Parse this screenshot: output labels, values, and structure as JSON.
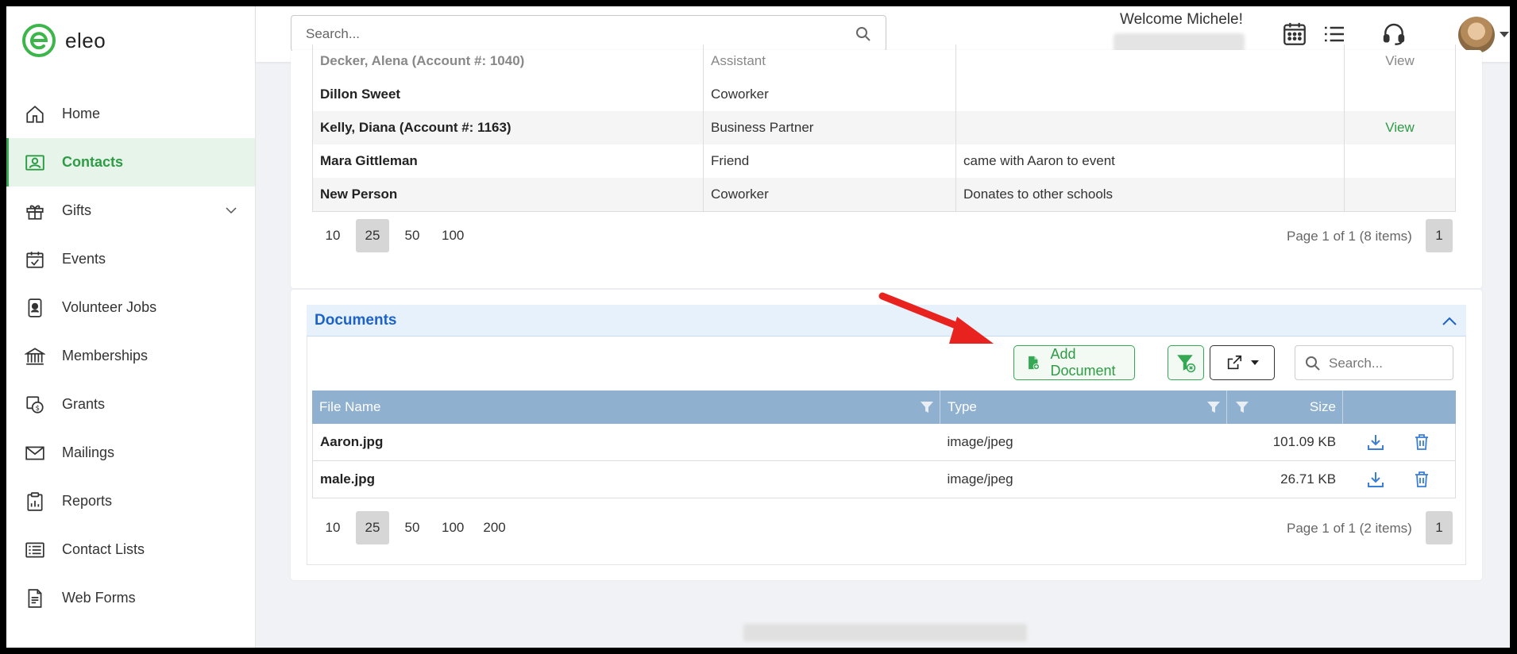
{
  "app": {
    "logo_letter": "e",
    "name": "eleo"
  },
  "sidebar": {
    "items": [
      {
        "label": "Home",
        "icon": "home-icon",
        "active": false
      },
      {
        "label": "Contacts",
        "icon": "contacts-icon",
        "active": true
      },
      {
        "label": "Gifts",
        "icon": "gift-icon",
        "active": false,
        "expandable": true
      },
      {
        "label": "Events",
        "icon": "calendar-check-icon",
        "active": false
      },
      {
        "label": "Volunteer Jobs",
        "icon": "badge-icon",
        "active": false
      },
      {
        "label": "Memberships",
        "icon": "institution-icon",
        "active": false
      },
      {
        "label": "Grants",
        "icon": "grant-icon",
        "active": false
      },
      {
        "label": "Mailings",
        "icon": "envelope-icon",
        "active": false
      },
      {
        "label": "Reports",
        "icon": "report-icon",
        "active": false
      },
      {
        "label": "Contact Lists",
        "icon": "list-icon",
        "active": false
      },
      {
        "label": "Web Forms",
        "icon": "form-icon",
        "active": false
      }
    ]
  },
  "topbar": {
    "search_placeholder": "Search...",
    "welcome": "Welcome Michele!",
    "icons": [
      "calendar-grid-icon",
      "list-icon",
      "headset-icon"
    ]
  },
  "contacts_table": {
    "rows": [
      {
        "name": "Decker, Alena (Account #: 1040)",
        "relationship": "Assistant",
        "note": "",
        "action": "View",
        "cut": true
      },
      {
        "name": "Dillon Sweet",
        "relationship": "Coworker",
        "note": "",
        "action": ""
      },
      {
        "name": "Kelly, Diana (Account #: 1163)",
        "relationship": "Business Partner",
        "note": "",
        "action": "View"
      },
      {
        "name": "Mara Gittleman",
        "relationship": "Friend",
        "note": "came with Aaron to event",
        "action": ""
      },
      {
        "name": "New Person",
        "relationship": "Coworker",
        "note": "Donates to other schools",
        "action": ""
      }
    ],
    "page_sizes": [
      "10",
      "25",
      "50",
      "100"
    ],
    "selected_page_size": "25",
    "page_info": "Page 1 of 1 (8 items)",
    "current_page": "1"
  },
  "documents": {
    "title": "Documents",
    "add_button": "Add Document",
    "search_placeholder": "Search...",
    "columns": {
      "file_name": "File Name",
      "type": "Type",
      "size": "Size"
    },
    "rows": [
      {
        "file_name": "Aaron.jpg",
        "type": "image/jpeg",
        "size": "101.09 KB"
      },
      {
        "file_name": "male.jpg",
        "type": "image/jpeg",
        "size": "26.71 KB"
      }
    ],
    "page_sizes": [
      "10",
      "25",
      "50",
      "100",
      "200"
    ],
    "selected_page_size": "25",
    "page_info": "Page 1 of 1 (2 items)",
    "current_page": "1"
  },
  "colors": {
    "brand_green": "#34a853",
    "link_blue": "#1d63c7",
    "grid_header": "#8fb0cf",
    "annotation_red": "#e8231f"
  }
}
